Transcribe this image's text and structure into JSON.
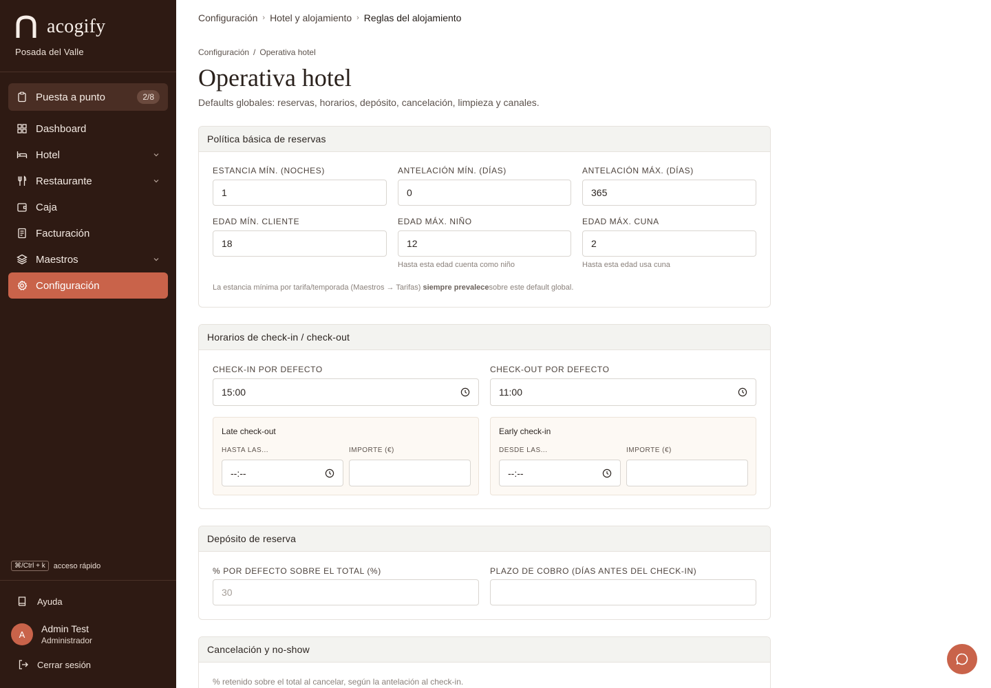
{
  "brand": {
    "name": "acogify",
    "property": "Posada del Valle"
  },
  "setup": {
    "label": "Puesta a punto",
    "badge": "2/8"
  },
  "nav": [
    {
      "label": "Dashboard",
      "icon": "grid-icon",
      "expandable": false,
      "active": false
    },
    {
      "label": "Hotel",
      "icon": "bed-icon",
      "expandable": true,
      "active": false
    },
    {
      "label": "Restaurante",
      "icon": "utensils-icon",
      "expandable": true,
      "active": false
    },
    {
      "label": "Caja",
      "icon": "wallet-icon",
      "expandable": false,
      "active": false
    },
    {
      "label": "Facturación",
      "icon": "receipt-icon",
      "expandable": false,
      "active": false
    },
    {
      "label": "Maestros",
      "icon": "layers-icon",
      "expandable": true,
      "active": false
    },
    {
      "label": "Configuración",
      "icon": "gear-icon",
      "expandable": false,
      "active": true
    }
  ],
  "shortcut": {
    "keys": "⌘/Ctrl + k",
    "label": "acceso rápido"
  },
  "help_label": "Ayuda",
  "user": {
    "initial": "A",
    "name": "Admin Test",
    "role": "Administrador"
  },
  "logout_label": "Cerrar sesión",
  "top_breadcrumb": [
    "Configuración",
    "Hotel y alojamiento",
    "Reglas del alojamiento"
  ],
  "breadcrumb": [
    "Configuración",
    "Operativa hotel"
  ],
  "breadcrumb_sep": "/",
  "page": {
    "title": "Operativa hotel",
    "subtitle": "Defaults globales: reservas, horarios, depósito, cancelación, limpieza y canales."
  },
  "booking_policy": {
    "title": "Política básica de reservas",
    "min_stay": {
      "label": "ESTANCIA MÍN. (NOCHES)",
      "value": "1"
    },
    "min_advance": {
      "label": "ANTELACIÓN MÍN. (DÍAS)",
      "value": "0"
    },
    "max_advance": {
      "label": "ANTELACIÓN MÁX. (DÍAS)",
      "value": "365"
    },
    "min_age": {
      "label": "EDAD MÍN. CLIENTE",
      "value": "18"
    },
    "max_child_age": {
      "label": "EDAD MÁX. NIÑO",
      "value": "12",
      "hint": "Hasta esta edad cuenta como niño"
    },
    "max_crib_age": {
      "label": "EDAD MÁX. CUNA",
      "value": "2",
      "hint": "Hasta esta edad usa cuna"
    },
    "note_pre": "La estancia mínima por tarifa/temporada (Maestros → Tarifas) ",
    "note_bold": "siempre prevalece",
    "note_post": "sobre este default global."
  },
  "schedules": {
    "title": "Horarios de check-in / check-out",
    "checkin": {
      "label": "CHECK-IN POR DEFECTO",
      "value": "15:00"
    },
    "checkout": {
      "label": "CHECK-OUT POR DEFECTO",
      "value": "11:00"
    },
    "late_checkout": {
      "title": "Late check-out",
      "until_label": "HASTA LAS...",
      "until_value": "--:--",
      "amount_label": "IMPORTE (€)",
      "amount_value": ""
    },
    "early_checkin": {
      "title": "Early check-in",
      "from_label": "DESDE LAS...",
      "from_value": "--:--",
      "amount_label": "IMPORTE (€)",
      "amount_value": ""
    }
  },
  "deposit": {
    "title": "Depósito de reserva",
    "percent": {
      "label": "% POR DEFECTO SOBRE EL TOTAL (%)",
      "placeholder": "30"
    },
    "term": {
      "label": "PLAZO DE COBRO (DÍAS ANTES DEL CHECK-IN)",
      "value": ""
    }
  },
  "cancellation": {
    "title": "Cancelación y no-show",
    "text": "% retenido sobre el total al cancelar, según la antelación al check-in."
  },
  "colors": {
    "sidebar": "#2e1a13",
    "accent": "#c9634a",
    "setup_bg": "#4a2e24"
  }
}
